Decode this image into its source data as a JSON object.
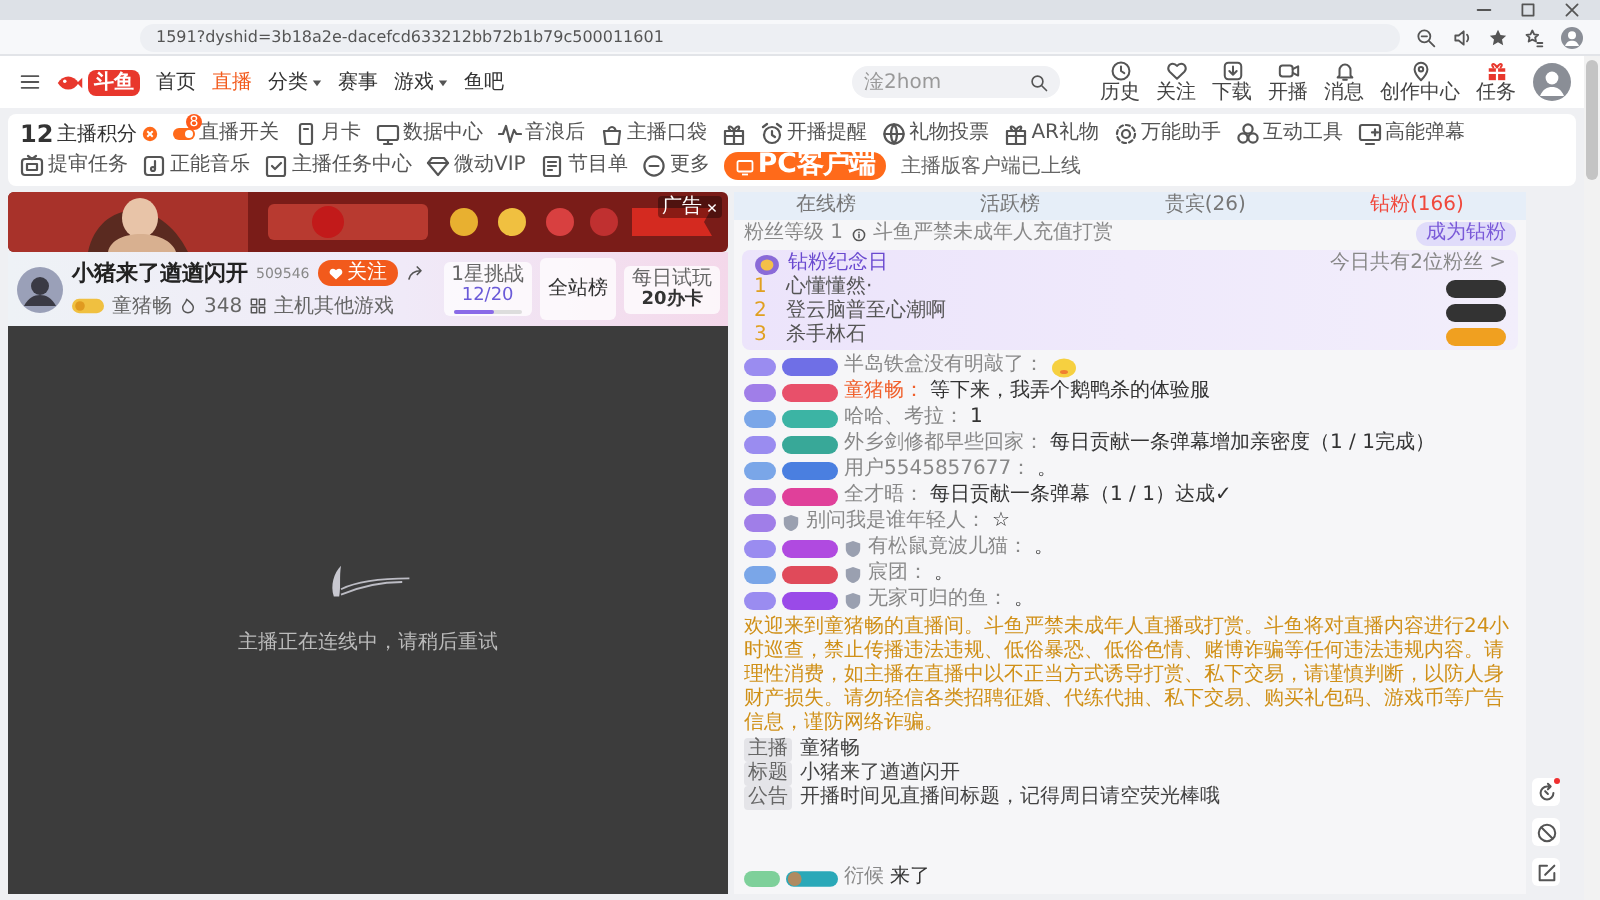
{
  "browser": {
    "url": "1591?dyshid=3b18a2e-dacefcd633212bb72b1b79c500011601"
  },
  "header": {
    "logo": "斗鱼",
    "nav": [
      {
        "label": "首页",
        "selected": false,
        "dropdown": false
      },
      {
        "label": "直播",
        "selected": true,
        "dropdown": false
      },
      {
        "label": "分类",
        "selected": false,
        "dropdown": true
      },
      {
        "label": "赛事",
        "selected": false,
        "dropdown": false
      },
      {
        "label": "游戏",
        "selected": false,
        "dropdown": true
      },
      {
        "label": "鱼吧",
        "selected": false,
        "dropdown": false
      }
    ],
    "search": {
      "placeholder": "淦2hom"
    },
    "actions": [
      {
        "label": "历史"
      },
      {
        "label": "关注"
      },
      {
        "label": "下载"
      },
      {
        "label": "开播"
      },
      {
        "label": "消息"
      },
      {
        "label": "创作中心"
      },
      {
        "label": "任务"
      }
    ]
  },
  "toolbar": {
    "score": {
      "value": "12",
      "label": "主播积分"
    },
    "tools": [
      {
        "kind": "labeled",
        "label": "直播开关",
        "badge": "8"
      },
      {
        "kind": "labeled",
        "label": "月卡"
      },
      {
        "kind": "labeled",
        "label": "数据中心"
      },
      {
        "kind": "labeled",
        "label": "音浪后"
      },
      {
        "kind": "labeled",
        "label": "主播口袋"
      },
      {
        "kind": "icon"
      },
      {
        "kind": "labeled",
        "label": "开播提醒"
      },
      {
        "kind": "labeled",
        "label": "礼物投票"
      },
      {
        "kind": "labeled",
        "label": "AR礼物"
      },
      {
        "kind": "labeled",
        "label": "万能助手"
      },
      {
        "kind": "labeled",
        "label": "互动工具"
      },
      {
        "kind": "labeled",
        "label": "高能弹幕"
      },
      {
        "kind": "labeled",
        "label": "提审任务"
      },
      {
        "kind": "labeled",
        "label": "正能音乐"
      },
      {
        "kind": "labeled",
        "label": "主播任务中心"
      },
      {
        "kind": "labeled",
        "label": "微动VIP"
      },
      {
        "kind": "labeled",
        "label": "节目单"
      },
      {
        "kind": "labeled",
        "label": "更多"
      }
    ],
    "client": {
      "label": "PC客户端",
      "note": "主播版客户端已上线"
    }
  },
  "banner": {
    "kind": "picture",
    "ad_label": "广告"
  },
  "streamer": {
    "title": "小猪来了遒遒闪开",
    "room_id": "509546",
    "follow": "关注",
    "host": "童猪畅",
    "hot": "348",
    "category": "主机其他游戏",
    "challenge": {
      "label": "1星挑战",
      "progress": "12/20",
      "level": 0.6
    },
    "rank": "全站榜",
    "daily": {
      "label": "每日试玩",
      "reward": "20办卡"
    }
  },
  "player": {
    "message": "主播正在连线中，请稍后重试"
  },
  "chat": {
    "tabs": [
      {
        "label": "在线榜",
        "selected": false
      },
      {
        "label": "活跃榜",
        "selected": false
      },
      {
        "label": "贵宾(26)",
        "selected": false
      },
      {
        "label": "钻粉(166)",
        "selected": true
      }
    ],
    "fan_level": "粉丝等级 1",
    "notice": "斗鱼严禁未成年人充值打赏",
    "join": "成为钻粉",
    "anniversary": {
      "title": "钻粉纪念日",
      "link": "今日共有2位粉丝 >",
      "ranks": [
        {
          "rank": "1",
          "name": "心懂懂然·",
          "color": "#333333"
        },
        {
          "rank": "2",
          "name": "登云脑普至心潮啊",
          "color": "#333333"
        },
        {
          "rank": "3",
          "name": "杀手林石",
          "color": "#f0a020"
        }
      ]
    },
    "messages": [
      {
        "kind": "sticker",
        "host": false,
        "medal": false,
        "badges": [
          {
            "color": "#9a8cf0"
          },
          {
            "color": "#6f6fe6"
          }
        ],
        "name": "半岛铁盒没有明敲了："
      },
      {
        "kind": "text",
        "host": true,
        "medal": false,
        "badges": [
          {
            "color": "#a07ee8"
          },
          {
            "color": "#e8506a"
          }
        ],
        "name": "童猪畅：",
        "text": "等下来，我弄个鹅鸭杀的体验服"
      },
      {
        "kind": "text",
        "host": false,
        "medal": false,
        "badges": [
          {
            "color": "#7aa6e8"
          },
          {
            "color": "#3cb4a4"
          }
        ],
        "name": "哈哈、考拉：",
        "text": "1"
      },
      {
        "kind": "text",
        "host": false,
        "medal": false,
        "badges": [
          {
            "color": "#9a8cf0"
          },
          {
            "color": "#38a898"
          }
        ],
        "name": "外乡剑修都早些回家：",
        "text": "每日贡献一条弹幕增加亲密度（1 / 1完成）"
      },
      {
        "kind": "text",
        "host": false,
        "medal": false,
        "badges": [
          {
            "color": "#7aa6e8"
          },
          {
            "color": "#4a7fe0"
          }
        ],
        "name": "用户5545857677：",
        "text": "。"
      },
      {
        "kind": "text",
        "host": false,
        "medal": false,
        "badges": [
          {
            "color": "#a07ee8"
          },
          {
            "color": "#e0409a"
          }
        ],
        "name": "全才晤：",
        "text": "每日贡献一条弹幕（1 / 1）达成✓"
      },
      {
        "kind": "text",
        "host": false,
        "medal": true,
        "badges": [
          {
            "color": "#a07ee8"
          }
        ],
        "name": "别问我是谁年轻人：",
        "text": "☆"
      },
      {
        "kind": "text",
        "host": false,
        "medal": true,
        "badges": [
          {
            "color": "#9a8cf0"
          },
          {
            "color": "#b04ae0"
          }
        ],
        "name": "有松鼠竟波儿猫：",
        "text": "。"
      },
      {
        "kind": "text",
        "host": false,
        "medal": true,
        "badges": [
          {
            "color": "#7aa6e8"
          },
          {
            "color": "#e04a5a"
          }
        ],
        "name": "宸团：",
        "text": "。"
      },
      {
        "kind": "text",
        "host": false,
        "medal": true,
        "badges": [
          {
            "color": "#9a8cf0"
          },
          {
            "color": "#9a4ae8"
          }
        ],
        "name": "无家可归的鱼：",
        "text": "。"
      }
    ],
    "system": "欢迎来到童猪畅的直播间。斗鱼严禁未成年人直播或打赏。斗鱼将对直播内容进行24小时巡查，禁止传播违法违规、低俗暴恐、低俗色情、赌博诈骗等任何违法违规内容。请理性消费，如主播在直播中以不正当方式诱导打赏、私下交易，请谨慎判断，以防人身财产损失。请勿轻信各类招聘征婚、代练代抽、私下交易、购买礼包码、游戏币等广告信息，谨防网络诈骗。",
    "info": [
      {
        "tag": "主播",
        "text": "童猪畅"
      },
      {
        "tag": "标题",
        "text": "小猪来了遒遒闪开"
      },
      {
        "tag": "公告",
        "text": "开播时间见直播间标题，记得周日请空荧光棒哦"
      }
    ],
    "arrival": {
      "name": "衍候",
      "text": "来了"
    }
  }
}
